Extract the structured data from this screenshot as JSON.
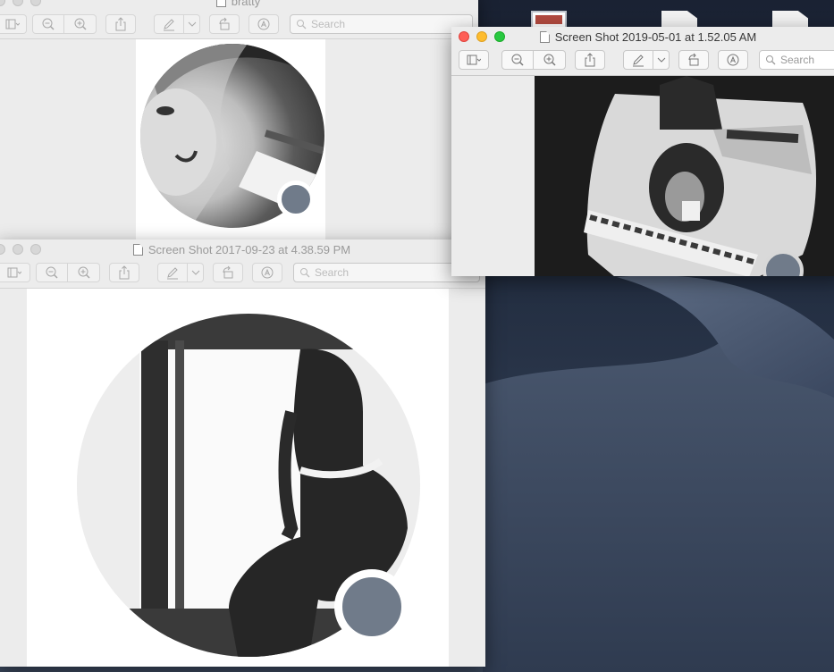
{
  "desktop": {
    "wallpaper": "mojave-dune-night",
    "accent_colors": {
      "sky": "#1a2233",
      "dune": "#3d4a60"
    }
  },
  "windows": {
    "top_left": {
      "title": "bratty",
      "search_placeholder": "Search",
      "active": false
    },
    "bottom_left": {
      "title": "Screen Shot 2017-09-23 at 4.38.59 PM",
      "search_placeholder": "Search",
      "active": false
    },
    "right": {
      "title": "Screen Shot 2019-05-01 at 1.52.05 AM",
      "search_placeholder": "Search",
      "active": true
    }
  },
  "icons": {
    "sidebar": "sidebar-toggle-icon",
    "zoom_out": "zoom-out-icon",
    "zoom_in": "zoom-in-icon",
    "share": "share-icon",
    "markup": "pen-markup-icon",
    "rotate": "rotate-icon",
    "annotate": "annotate-circle-a-icon",
    "search": "magnifier-icon"
  },
  "colors": {
    "status_badge": "#707b8a",
    "traffic_close": "#fe5f57",
    "traffic_min": "#febc2e",
    "traffic_zoom": "#28c840"
  }
}
